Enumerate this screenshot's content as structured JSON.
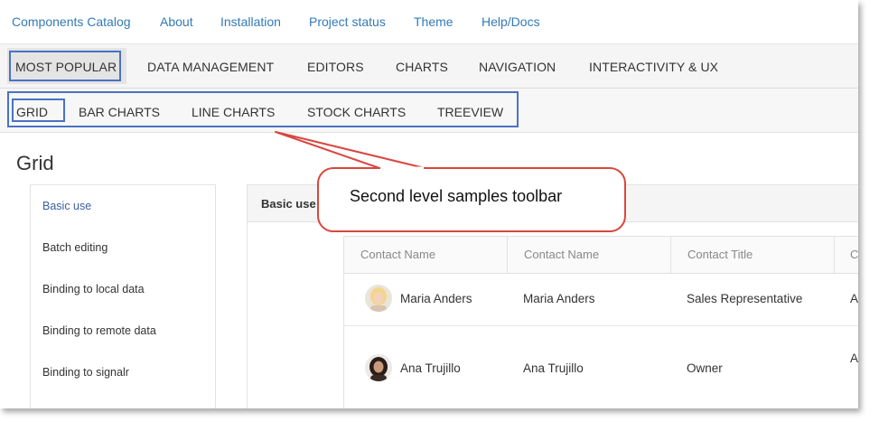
{
  "topnav": {
    "brand": "Components Catalog",
    "links": [
      "About",
      "Installation",
      "Project status",
      "Theme",
      "Help/Docs"
    ]
  },
  "level1": {
    "items": [
      "MOST POPULAR",
      "DATA MANAGEMENT",
      "EDITORS",
      "CHARTS",
      "NAVIGATION",
      "INTERACTIVITY & UX"
    ],
    "active": "MOST POPULAR"
  },
  "level2": {
    "items": [
      "GRID",
      "BAR CHARTS",
      "LINE CHARTS",
      "STOCK CHARTS",
      "TREEVIEW"
    ],
    "active": "GRID"
  },
  "page": {
    "title": "Grid"
  },
  "sidebar": {
    "items": [
      "Basic use",
      "Batch editing",
      "Binding to local data",
      "Binding to remote data",
      "Binding to signalr"
    ]
  },
  "panel": {
    "title": "Basic use"
  },
  "grid": {
    "columns": [
      "Contact Name",
      "Contact Name",
      "Contact Title",
      "C"
    ],
    "rows": [
      {
        "name": "Maria Anders",
        "name2": "Maria Anders",
        "title": "Sales Representative",
        "extra": "A"
      },
      {
        "name": "Ana Trujillo",
        "name2": "Ana Trujillo",
        "title": "Owner",
        "extra": "A"
      }
    ]
  },
  "callout": {
    "text": "Second level samples toolbar"
  },
  "colors": {
    "accent_link": "#337ab7",
    "annotation_blue": "#4a72c4",
    "annotation_red": "#d9473e"
  }
}
